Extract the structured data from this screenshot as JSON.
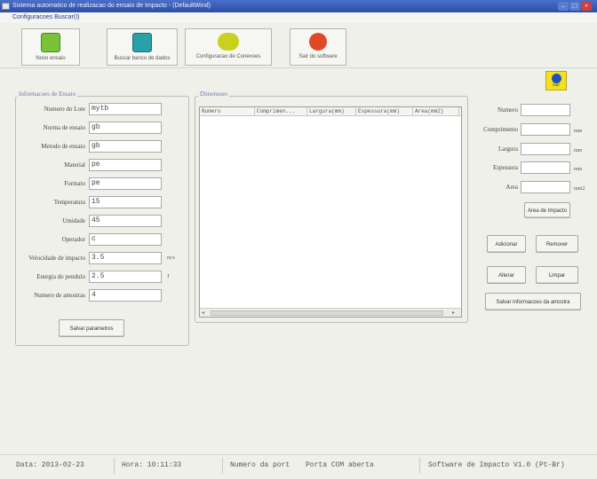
{
  "window": {
    "title": "Sistema automatico de realizacao do ensaio de Impacto - (DefaultWind)",
    "menu": "Configuracoes  Buscar(I)"
  },
  "toolbar": {
    "buttons": [
      {
        "label": "Novo ensaio",
        "icon": "check-pencil-icon"
      },
      {
        "label": "Buscar banco de dados",
        "icon": "search-document-icon"
      },
      {
        "label": "Configuracao de Conexoes",
        "icon": "connection-icon"
      },
      {
        "label": "Sair do software",
        "icon": "close-icon"
      }
    ]
  },
  "info_panel": {
    "legend": "Informacoes de Ensaio",
    "fields": [
      {
        "label": "Numero do Lote",
        "value": "mytb"
      },
      {
        "label": "Norma de ensaio",
        "value": "gb"
      },
      {
        "label": "Metodo de ensaio",
        "value": "gb"
      },
      {
        "label": "Material",
        "value": "pe"
      },
      {
        "label": "Formato",
        "value": "pe"
      },
      {
        "label": "Temperatura",
        "value": "15"
      },
      {
        "label": "Umidade",
        "value": "45"
      },
      {
        "label": "Operador",
        "value": "c"
      },
      {
        "label": "Velocidade de impacto",
        "value": "3.5",
        "unit": "m/s"
      },
      {
        "label": "Energia do pendulo",
        "value": "2.5",
        "unit": "J"
      },
      {
        "label": "Numero de amostras",
        "value": "4"
      }
    ],
    "save_button": "Salvar parametros"
  },
  "dimensions": {
    "legend": "Dimensoes",
    "columns": [
      "Numero",
      "Comprimen...",
      "Largura(mm)",
      "Espessura(mm)",
      "Area(mm2)"
    ]
  },
  "right_panel": {
    "fields": [
      {
        "label": "Numero",
        "value": "",
        "unit": ""
      },
      {
        "label": "Comprimento",
        "value": "",
        "unit": "mm"
      },
      {
        "label": "Largura",
        "value": "",
        "unit": "mm"
      },
      {
        "label": "Espessura",
        "value": "",
        "unit": "mm"
      },
      {
        "label": "Area",
        "value": "",
        "unit": "mm2"
      }
    ],
    "buttons": {
      "impact_area": "Area de Impacto",
      "add": "Adicionar",
      "remove": "Remover",
      "modify": "Alterar",
      "clear": "Limpar",
      "save_samples": "Salvar informacoes da amostra"
    },
    "help_label": "Sair"
  },
  "status_bar": {
    "date": "Data: 2013-02-23",
    "time": "Hora: 10:11:33",
    "port": "Numero da port",
    "com": "Porta COM aberta",
    "version": "Software de Impacto V1.0 (Pt-Br)"
  }
}
